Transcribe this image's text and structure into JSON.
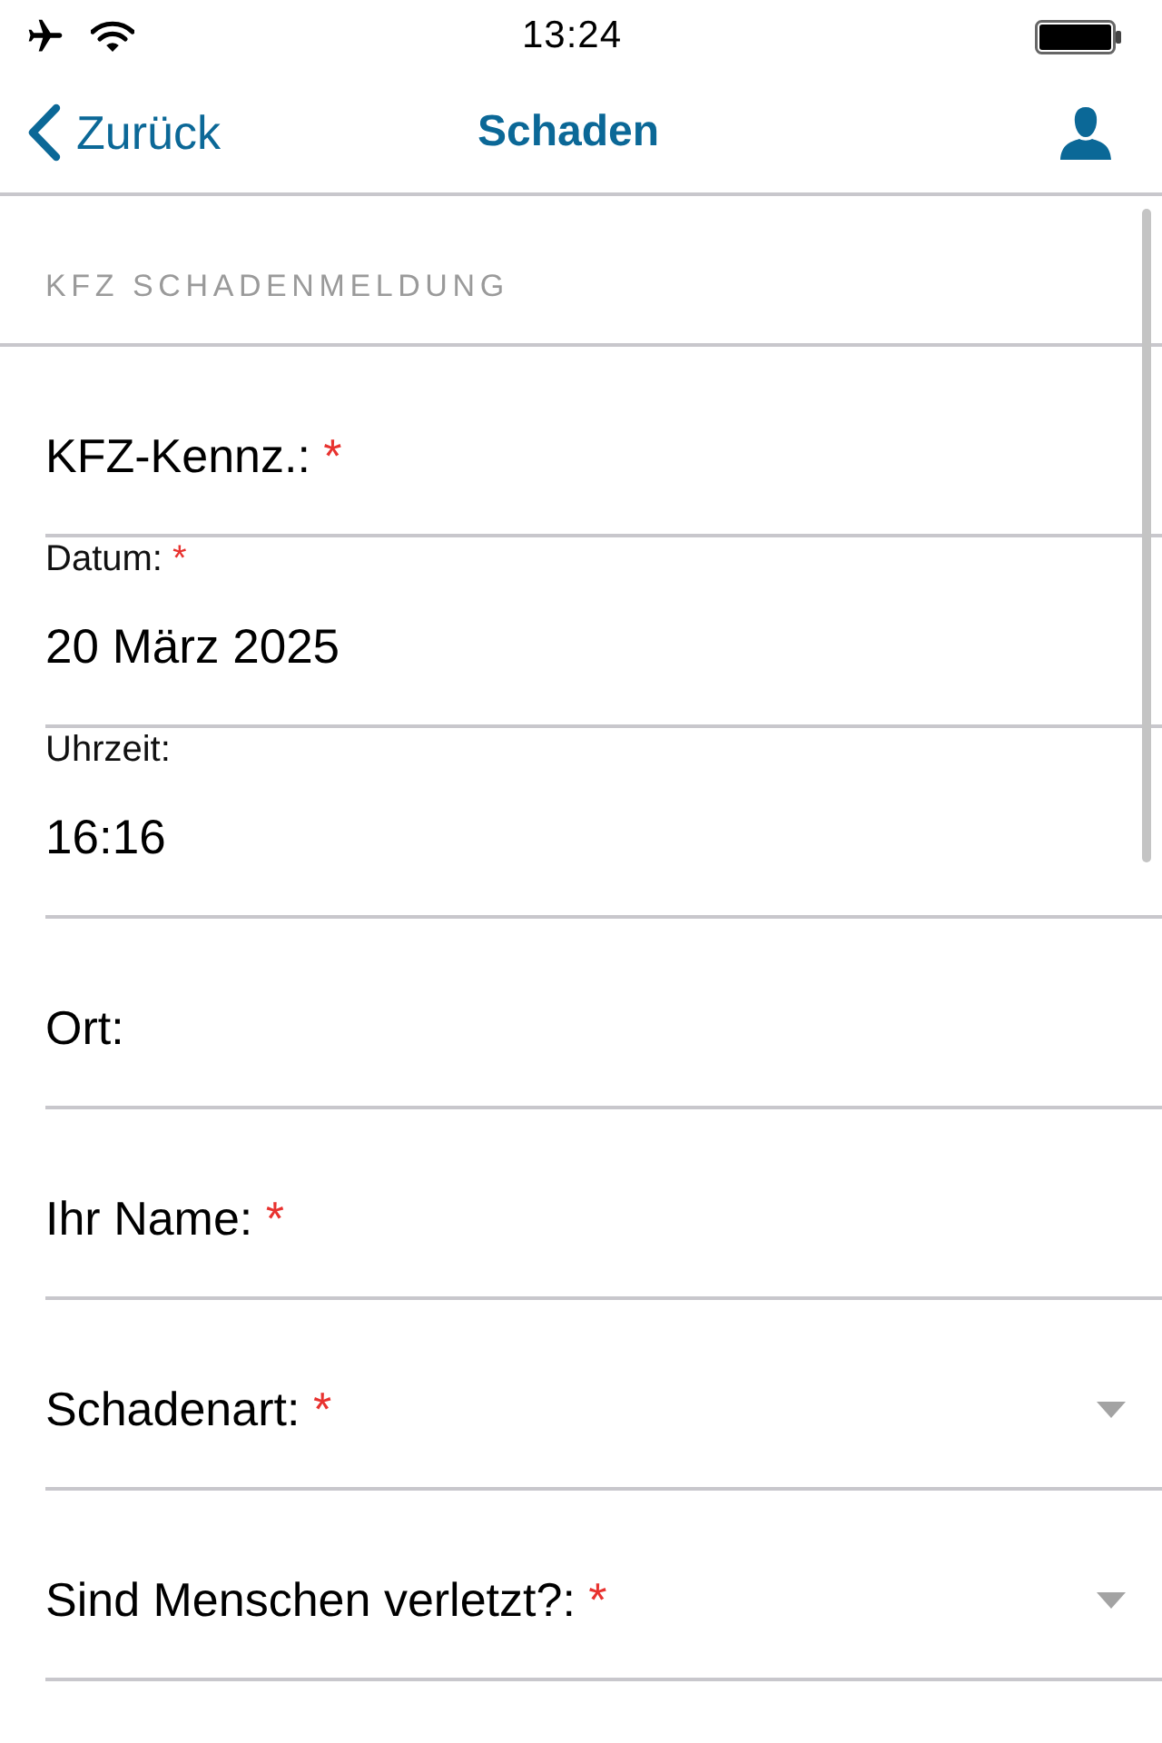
{
  "status_bar": {
    "time": "13:24"
  },
  "nav_bar": {
    "back": "Zurück",
    "title": "Schaden"
  },
  "section": {
    "title": "KFZ SCHADENMELDUNG"
  },
  "fields": [
    {
      "kind": "text",
      "label": "KFZ-Kennz.:",
      "required_mark": "*"
    },
    {
      "kind": "date",
      "label": "Datum:",
      "required_mark": "*",
      "value": "20 März 2025"
    },
    {
      "kind": "time",
      "label": "Uhrzeit:",
      "value": "16:16"
    },
    {
      "kind": "text",
      "label": "Ort:"
    },
    {
      "kind": "text",
      "label": "Ihr Name:",
      "required_mark": "*"
    },
    {
      "kind": "select",
      "label": "Schadenart:",
      "required_mark": "*"
    },
    {
      "kind": "select",
      "label": "Sind Menschen verletzt?:",
      "required_mark": "*"
    }
  ]
}
